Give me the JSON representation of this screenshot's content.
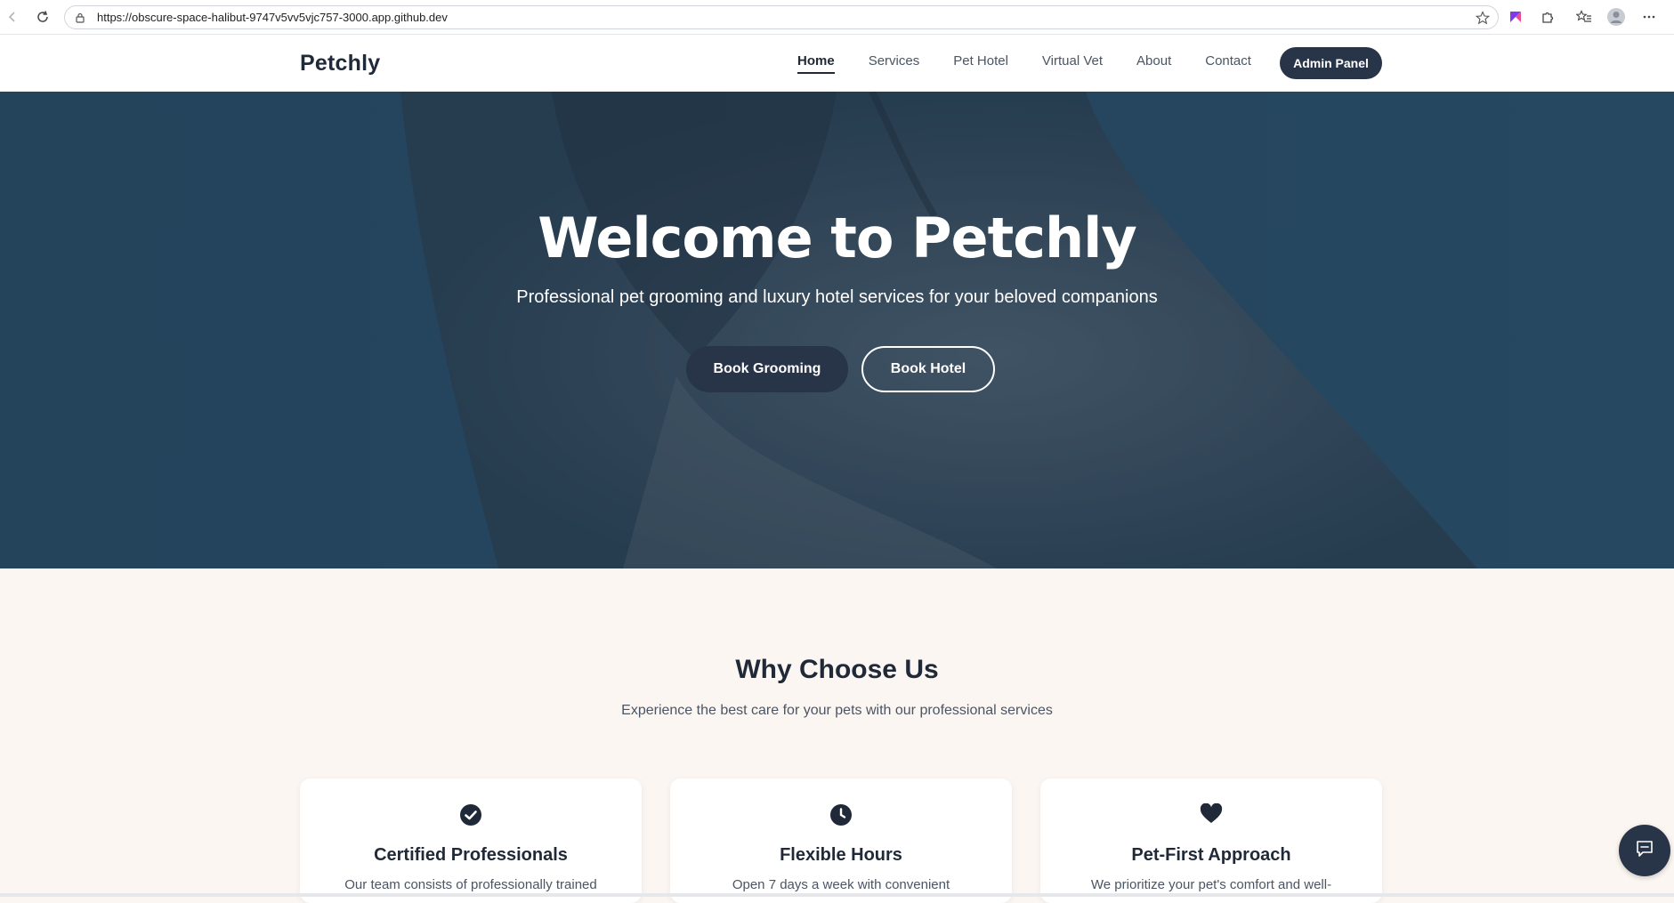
{
  "browser": {
    "url": "https://obscure-space-halibut-9747v5vv5vjc757-3000.app.github.dev"
  },
  "header": {
    "brand": "Petchly",
    "nav": [
      {
        "label": "Home",
        "active": true
      },
      {
        "label": "Services",
        "active": false
      },
      {
        "label": "Pet Hotel",
        "active": false
      },
      {
        "label": "Virtual Vet",
        "active": false
      },
      {
        "label": "About",
        "active": false
      },
      {
        "label": "Contact",
        "active": false
      }
    ],
    "admin_label": "Admin Panel"
  },
  "hero": {
    "title": "Welcome to Petchly",
    "subtitle": "Professional pet grooming and luxury hotel services for your beloved companions",
    "primary_cta": "Book Grooming",
    "secondary_cta": "Book Hotel"
  },
  "why": {
    "title": "Why Choose Us",
    "subtitle": "Experience the best care for your pets with our professional services",
    "cards": [
      {
        "icon": "check-circle-icon",
        "title": "Certified Professionals",
        "desc": "Our team consists of professionally trained"
      },
      {
        "icon": "clock-icon",
        "title": "Flexible Hours",
        "desc": "Open 7 days a week with convenient"
      },
      {
        "icon": "heart-icon",
        "title": "Pet-First Approach",
        "desc": "We prioritize your pet's comfort and well-"
      }
    ]
  },
  "colors": {
    "primary": "#283447",
    "background": "#fcf6f2",
    "hero_overlay": "#2a4a60"
  }
}
